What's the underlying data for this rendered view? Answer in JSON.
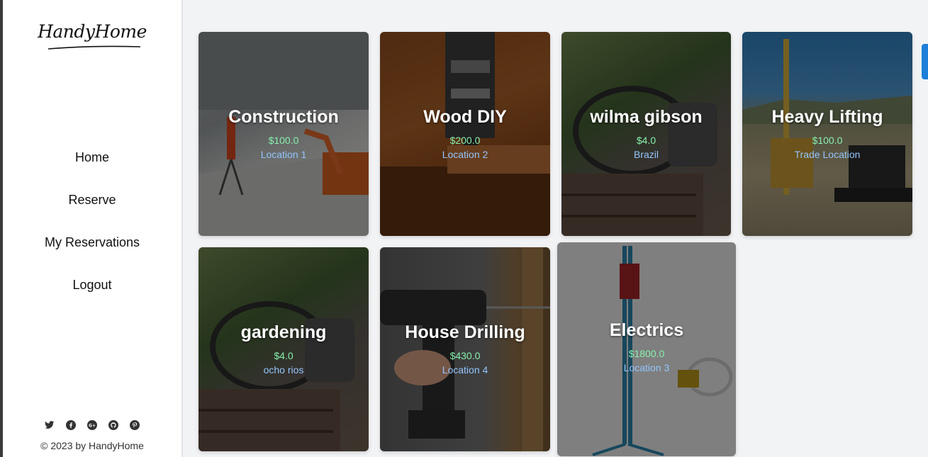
{
  "brand": {
    "logo_text": "HandyHome"
  },
  "nav": {
    "items": [
      {
        "label": "Home"
      },
      {
        "label": "Reserve"
      },
      {
        "label": "My Reservations"
      },
      {
        "label": "Logout"
      }
    ]
  },
  "footer": {
    "social_icons": [
      "twitter-icon",
      "facebook-icon",
      "google-plus-icon",
      "github-icon",
      "pinterest-icon"
    ],
    "copyright": "© 2023 by HandyHome"
  },
  "cards": [
    {
      "title": "Construction",
      "price": "$100.0",
      "location": "Location 1"
    },
    {
      "title": "Wood DIY",
      "price": "$200.0",
      "location": "Location 2"
    },
    {
      "title": "wilma gibson",
      "price": "$4.0",
      "location": "Brazil"
    },
    {
      "title": "Heavy Lifting",
      "price": "$100.0",
      "location": "Trade Location"
    },
    {
      "title": "gardening",
      "price": "$4.0",
      "location": "ocho rios"
    },
    {
      "title": "House Drilling",
      "price": "$430.0",
      "location": "Location 4"
    },
    {
      "title": "Electrics",
      "price": "$1800.0",
      "location": "Location 3"
    }
  ],
  "colors": {
    "price": "#86efac",
    "location": "#93c5fd",
    "scrollbar": "#1d7fd8"
  }
}
